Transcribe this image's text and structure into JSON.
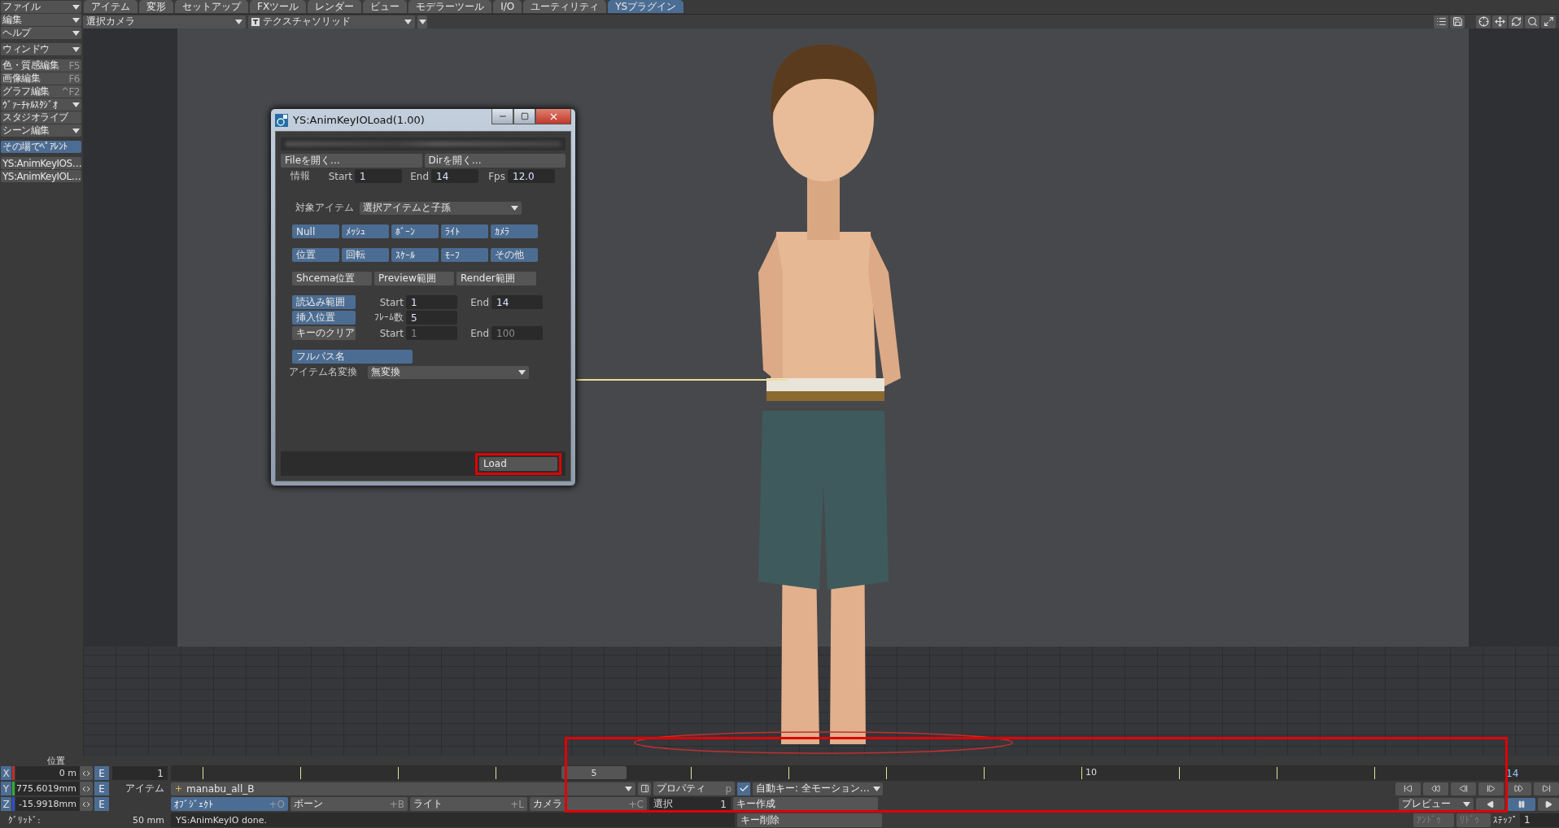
{
  "tabs": [
    {
      "label": "アイテム",
      "selected": false
    },
    {
      "label": "変形",
      "selected": false
    },
    {
      "label": "セットアップ",
      "selected": false
    },
    {
      "label": "FXツール",
      "selected": false
    },
    {
      "label": "レンダー",
      "selected": false
    },
    {
      "label": "ビュー",
      "selected": false
    },
    {
      "label": "モデラーツール",
      "selected": false
    },
    {
      "label": "I/O",
      "selected": false
    },
    {
      "label": "ユーティリティ",
      "selected": false
    },
    {
      "label": "YSプラグイン",
      "selected": true
    }
  ],
  "sidebar": {
    "groups": [
      {
        "items": [
          {
            "label": "ファイル",
            "kind": "dropdown",
            "selected": false
          },
          {
            "label": "編集",
            "kind": "dropdown",
            "selected": false
          },
          {
            "label": "ヘルプ",
            "kind": "dropdown",
            "selected": false
          }
        ]
      },
      {
        "items": [
          {
            "label": "ウィンドウ",
            "kind": "dropdown",
            "selected": false
          }
        ]
      },
      {
        "items": [
          {
            "label": "色・質感編集",
            "kind": "shortcut",
            "shortcut": "F5",
            "selected": false
          },
          {
            "label": "画像編集",
            "kind": "shortcut",
            "shortcut": "F6",
            "selected": false
          },
          {
            "label": "グラフ編集",
            "kind": "shortcut",
            "shortcut": "^F2",
            "selected": false
          },
          {
            "label": "ｳﾞｧｰﾁｬﾙｽﾀｼﾞｵ",
            "kind": "dropdown",
            "selected": false
          },
          {
            "label": "スタジオライブ",
            "kind": "plain",
            "selected": false
          },
          {
            "label": "シーン編集",
            "kind": "dropdown",
            "selected": false
          }
        ]
      },
      {
        "items": [
          {
            "label": "その場でﾍﾟｱﾚﾝﾄ",
            "kind": "plain",
            "selected": true
          }
        ]
      },
      {
        "items": [
          {
            "label": "YS:AnimKeyIOS…",
            "kind": "plain",
            "selected": false
          },
          {
            "label": "YS:AnimKeyIOL…",
            "kind": "plain",
            "selected": false
          }
        ]
      }
    ]
  },
  "view": {
    "camera": "選択カメラ",
    "shading": "テクスチャソリッド"
  },
  "dialog": {
    "title": "YS:AnimKeyIOLoad(1.00)",
    "open_buttons": [
      "Fileを開く...",
      "Dirを開く..."
    ],
    "info": {
      "label": "情報",
      "fields": [
        {
          "label": "Start",
          "value": "1"
        },
        {
          "label": "End",
          "value": "14"
        },
        {
          "label": "Fps",
          "value": "12.0"
        }
      ]
    },
    "target": {
      "label": "対象アイテム",
      "value": "選択アイテムと子孫"
    },
    "item_types": [
      {
        "label": "Null",
        "selected": true
      },
      {
        "label": "ﾒｯｼｭ",
        "selected": true
      },
      {
        "label": "ﾎﾞｰﾝ",
        "selected": true
      },
      {
        "label": "ﾗｲﾄ",
        "selected": true
      },
      {
        "label": "ｶﾒﾗ",
        "selected": true
      }
    ],
    "channels": [
      {
        "label": "位置",
        "selected": true
      },
      {
        "label": "回転",
        "selected": true
      },
      {
        "label": "ｽｹｰﾙ",
        "selected": true
      },
      {
        "label": "ﾓｰﾌ",
        "selected": true
      },
      {
        "label": "その他",
        "selected": true
      }
    ],
    "ranges": [
      {
        "label": "Shcema位置",
        "selected": false
      },
      {
        "label": "Preview範囲",
        "selected": false
      },
      {
        "label": "Render範囲",
        "selected": false
      }
    ],
    "options": [
      {
        "label": "読込み範囲",
        "selected": true,
        "fields": [
          {
            "label": "Start",
            "value": "1"
          },
          {
            "label": "End",
            "value": "14"
          }
        ]
      },
      {
        "label": "挿入位置",
        "selected": true,
        "fields": [
          {
            "label": "ﾌﾚｰﾑ数",
            "value": "5"
          }
        ]
      },
      {
        "label": "キーのクリア",
        "selected": false,
        "fields": [
          {
            "label": "Start",
            "value": "1"
          },
          {
            "label": "End",
            "value": "100"
          }
        ]
      }
    ],
    "full_path": {
      "label": "フルパス名",
      "selected": true
    },
    "rename": {
      "label": "アイテム名変換",
      "value": "無変換"
    },
    "load_button": {
      "label": "Load",
      "highlighted": true
    }
  },
  "bottom": {
    "position_label": "位置",
    "coords": [
      {
        "axis": "X",
        "value": "0 m",
        "color": "#c03030",
        "edit": "E"
      },
      {
        "axis": "Y",
        "value": "775.6019mm",
        "color": "#30b030",
        "edit": "E"
      },
      {
        "axis": "Z",
        "value": "-15.9918mm",
        "color": "#3050d0",
        "edit": "E"
      }
    ],
    "timeline": {
      "start": "1",
      "current": "5",
      "label": "10",
      "end": "14",
      "highlighted": true
    },
    "item": {
      "label": "アイテム",
      "value": "manabu_all_B"
    },
    "properties": {
      "label": "プロパティ",
      "shortcut": "p"
    },
    "auto_key": {
      "checked": true,
      "label": "自動キー: 全モーション…"
    },
    "item_types": [
      {
        "label": "ｵﾌﾞｼﾞｪｸﾄ",
        "shortcut": "+O",
        "selected": true
      },
      {
        "label": "ボーン",
        "shortcut": "+B",
        "selected": false
      },
      {
        "label": "ライト",
        "shortcut": "+L",
        "selected": false
      },
      {
        "label": "カメラ",
        "shortcut": "+C",
        "selected": false
      }
    ],
    "selection": {
      "label": "選択",
      "value": "1"
    },
    "create_key": "キー作成",
    "delete_key": "キー削除",
    "grid": {
      "label": "ｸﾞﾘｯﾄﾞ:",
      "value": "50 mm"
    },
    "status": "YS:AnimKeyIO done.",
    "transport": [
      {
        "kind": "first"
      },
      {
        "kind": "prev_key"
      },
      {
        "kind": "prev"
      },
      {
        "kind": "next"
      },
      {
        "kind": "next_key"
      },
      {
        "kind": "last"
      }
    ],
    "preview": "プレビュー",
    "playback": [
      {
        "kind": "reverse",
        "selected": false
      },
      {
        "kind": "pause",
        "selected": true
      },
      {
        "kind": "play",
        "selected": false
      }
    ],
    "undo": {
      "label": "ｱﾝﾄﾞｩ",
      "disabled": true
    },
    "redo": {
      "label": "ﾘﾄﾞｩ",
      "disabled": true
    },
    "step": {
      "label": "ｽﾃｯﾌﾟ",
      "value": "1"
    }
  }
}
